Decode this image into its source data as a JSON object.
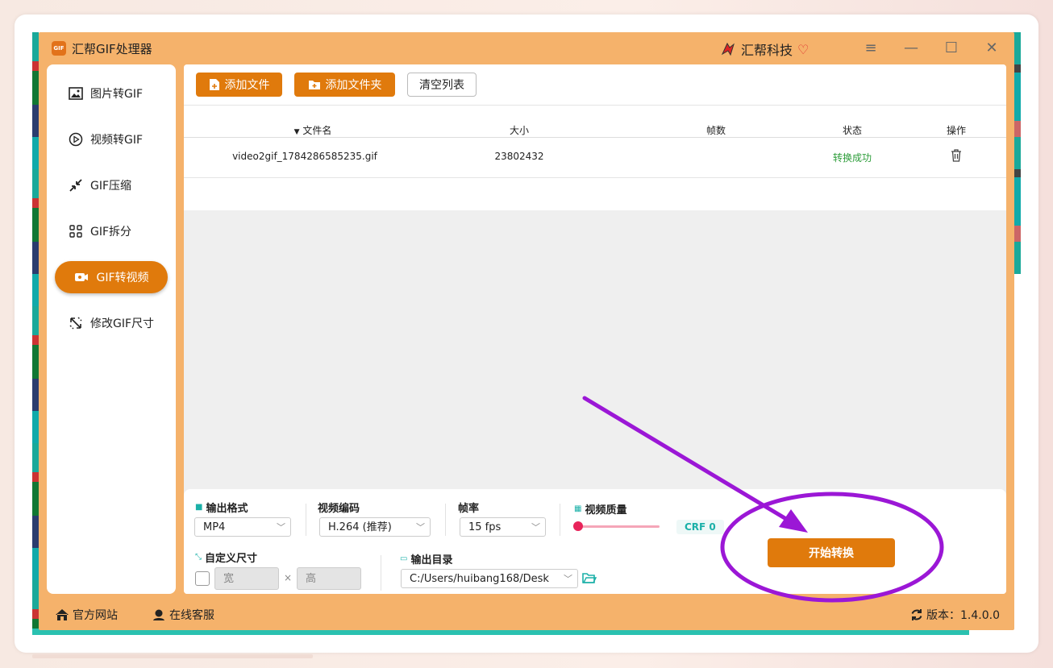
{
  "window": {
    "title": "汇帮GIF处理器",
    "logo_text": "GIF",
    "brand": "汇帮科技",
    "controls": [
      "≡",
      "—",
      "☐",
      "✕"
    ]
  },
  "sidebar": {
    "items": [
      {
        "label": "图片转GIF",
        "icon": "image-icon",
        "active": false
      },
      {
        "label": "视频转GIF",
        "icon": "play-circle-icon",
        "active": false
      },
      {
        "label": "GIF压缩",
        "icon": "compress-icon",
        "active": false
      },
      {
        "label": "GIF拆分",
        "icon": "split-icon",
        "active": false
      },
      {
        "label": "GIF转视频",
        "icon": "video-icon",
        "active": true
      },
      {
        "label": "修改GIF尺寸",
        "icon": "resize-icon",
        "active": false
      }
    ]
  },
  "toolbar": {
    "add_file": "添加文件",
    "add_folder": "添加文件夹",
    "clear_list": "清空列表"
  },
  "file_table": {
    "columns": [
      "文件名",
      "大小",
      "帧数",
      "状态",
      "操作"
    ],
    "rows": [
      {
        "name": "video2gif_1784286585235.gif",
        "size": "23802432",
        "frames": "",
        "status": "转换成功"
      }
    ]
  },
  "settings": {
    "output_format_label": "输出格式",
    "output_format_value": "MP4",
    "codec_label": "视频编码",
    "codec_value": "H.264 (推荐)",
    "fps_label": "帧率",
    "fps_value": "15 fps",
    "quality_label": "视频质量",
    "quality_value": 0,
    "crf_text": "CRF 0",
    "custom_size_label": "自定义尺寸",
    "custom_size_checked": false,
    "width_placeholder": "宽",
    "times": "×",
    "height_placeholder": "高",
    "output_dir_label": "输出目录",
    "output_dir_value": "C:/Users/huibang168/Desk",
    "start_button": "开始转换"
  },
  "footer": {
    "official_site": "官方网站",
    "support": "在线客服",
    "version_label": "版本：1.4.0.0"
  },
  "colors": {
    "accent": "#e07a0c",
    "app_bg": "#f5b26b",
    "success": "#2d9d3a",
    "annotation": "#9b17d6"
  }
}
